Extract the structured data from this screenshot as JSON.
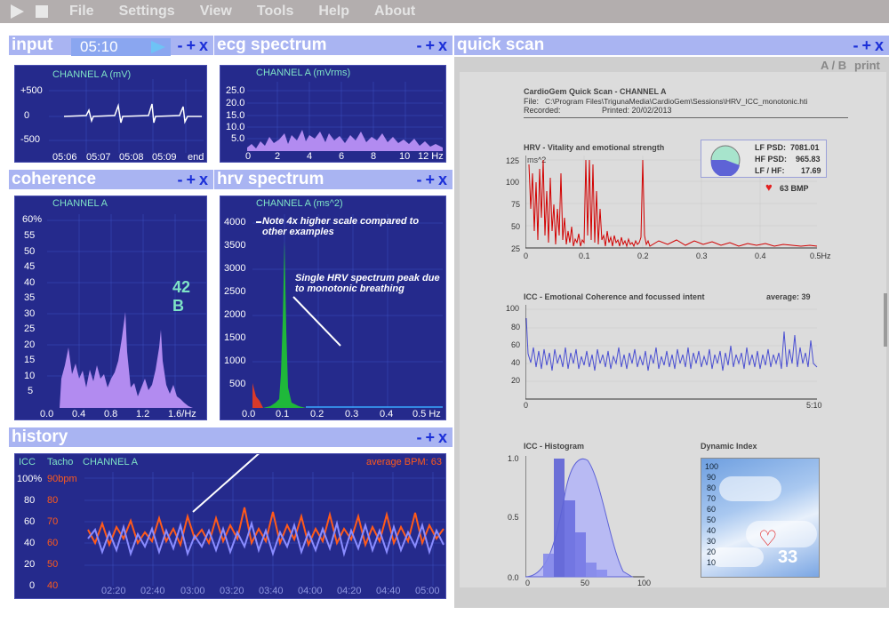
{
  "menu": {
    "items": [
      "File",
      "Settings",
      "View",
      "Tools",
      "Help",
      "About"
    ]
  },
  "colors": {
    "titlebar": "#a9b4f2",
    "plot_bg": "#252a8c",
    "accent": "#1b2fd8",
    "purple": "#b28bf0",
    "red_line": "#ff5a1a",
    "blue_line": "#8a8cff"
  },
  "panes": {
    "input": {
      "title": "input",
      "timer": "05:10",
      "controls": [
        "-",
        "+",
        "x"
      ],
      "channel": "CHANNEL A (mV)",
      "y_ticks": [
        "+500",
        "0",
        "-500"
      ],
      "x_ticks": [
        "05:06",
        "05:07",
        "05:08",
        "05:09",
        "end"
      ]
    },
    "ecg": {
      "title": "ecg spectrum",
      "controls": [
        "-",
        "+",
        "x"
      ],
      "channel": "CHANNEL A (mVrms)",
      "y_ticks": [
        "25.0",
        "20.0",
        "15.0",
        "10.0",
        "5.0"
      ],
      "x_ticks": [
        "0",
        "2",
        "4",
        "6",
        "8",
        "10",
        "12 Hz"
      ]
    },
    "coherence": {
      "title": "coherence",
      "controls": [
        "-",
        "+",
        "x"
      ],
      "channel": "CHANNEL A",
      "value": "42 B",
      "y_ticks": [
        "60%",
        "55",
        "50",
        "45",
        "40",
        "35",
        "30",
        "25",
        "20",
        "15",
        "10",
        "5"
      ],
      "x_ticks": [
        "0.0",
        "0.4",
        "0.8",
        "1.2",
        "1.6/Hz"
      ]
    },
    "hrv": {
      "title": "hrv spectrum",
      "controls": [
        "-",
        "+",
        "x"
      ],
      "channel": "CHANNEL A (ms^2)",
      "y_ticks": [
        "4000",
        "3500",
        "3000",
        "2500",
        "2000",
        "1500",
        "1000",
        "500"
      ],
      "x_ticks": [
        "0.0",
        "0.1",
        "0.2",
        "0.3",
        "0.4",
        "0.5 Hz"
      ],
      "note1": "Note 4x higher scale compared to other examples",
      "note2": "Single HRV spectrum peak due to monotonic breathing"
    },
    "history": {
      "title": "history",
      "controls": [
        "-",
        "+",
        "x"
      ],
      "col1": "ICC",
      "col2": "Tacho",
      "channel": "CHANNEL A",
      "avg": "average BPM: 63",
      "icc_ticks": [
        "100%",
        "80",
        "60",
        "40",
        "20",
        "0"
      ],
      "tacho_ticks": [
        "90bpm",
        "80",
        "70",
        "60",
        "50",
        "40"
      ],
      "x_ticks": [
        "02:20",
        "02:40",
        "03:00",
        "03:20",
        "03:40",
        "04:00",
        "04:20",
        "04:40",
        "05:00"
      ]
    },
    "quick": {
      "title": "quick scan",
      "controls": [
        "-",
        "+",
        "x"
      ],
      "links": "A / B",
      "print": "print"
    }
  },
  "report": {
    "heading": "CardioGem Quick Scan - CHANNEL A",
    "file_label": "File:",
    "file": "C:\\Program Files\\TrigunaMedia\\CardioGem\\Sessions\\HRV_ICC_monotonic.hti",
    "recorded_label": "Recorded:",
    "printed": "Printed: 20/02/2013",
    "hrv_title": "HRV - Vitality and emotional strength",
    "hrv_unit": "ms^2",
    "hrv_y": [
      "125",
      "100",
      "75",
      "50",
      "25"
    ],
    "hrv_x": [
      "0",
      "0.1",
      "0.2",
      "0.3",
      "0.4",
      "0.5Hz"
    ],
    "lf_label": "LF PSD:",
    "lf": "7081.01",
    "hf_label": "HF PSD:",
    "hf": "965.83",
    "lfhf_label": "LF / HF:",
    "lfhf": "17.69",
    "bpm": "63 BMP",
    "icc_title": "ICC - Emotional Coherence and focussed intent",
    "icc_avg": "average: 39",
    "icc_y": [
      "100",
      "80",
      "60",
      "40",
      "20"
    ],
    "icc_x": [
      "0",
      "5:10"
    ],
    "hist_title": "ICC - Histogram",
    "hist_y": [
      "1.0",
      "0.5",
      "0.0"
    ],
    "hist_x": [
      "0",
      "50",
      "100"
    ],
    "dyn_title": "Dynamic Index",
    "dyn_y": [
      "100",
      "90",
      "80",
      "70",
      "60",
      "50",
      "40",
      "30",
      "20",
      "10"
    ],
    "dyn_value": "33"
  }
}
